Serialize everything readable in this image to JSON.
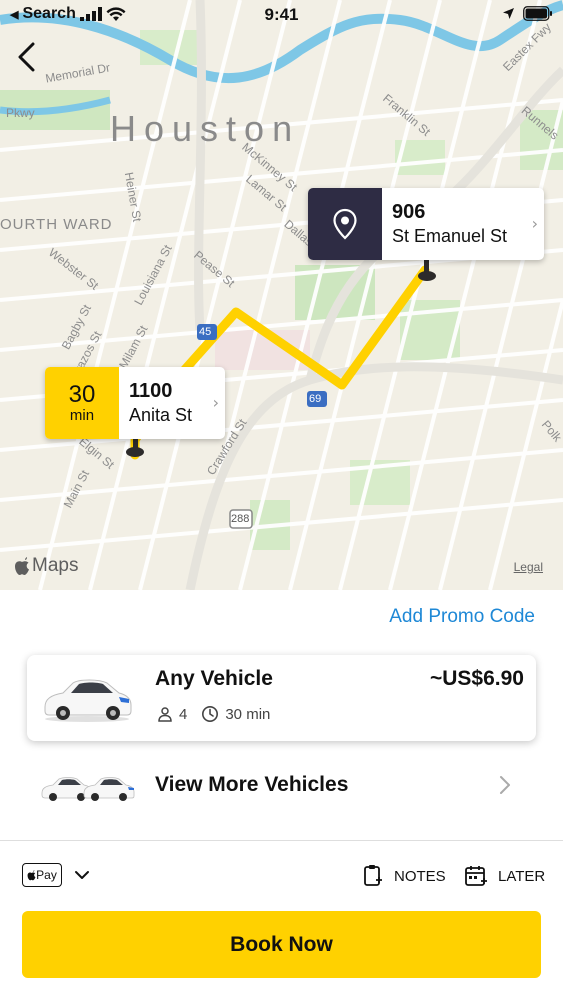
{
  "status_bar": {
    "back_app": "Search",
    "time": "9:41"
  },
  "map": {
    "city": "Houston",
    "streets": [
      "Memorial Dr",
      "Pkwy",
      "Franklin St",
      "Eastex Fwy",
      "Runnels",
      "McKinney St",
      "Lamar St",
      "Dallas",
      "Heiner St",
      "Webster St",
      "Louisiana St",
      "Pease St",
      "Bagby St",
      "Brazos St",
      "Milam St",
      "Elgin St",
      "Main St",
      "Crawford St",
      "Polk"
    ],
    "ward": "OURTH WARD",
    "highway_shields": [
      "45",
      "69",
      "288"
    ],
    "provider": "Maps",
    "legal": "Legal"
  },
  "destination": {
    "number": "906",
    "street": "St Emanuel St"
  },
  "pickup": {
    "eta_value": "30",
    "eta_unit": "min",
    "number": "1100",
    "street": "Anita St"
  },
  "promo_label": "Add Promo Code",
  "vehicle": {
    "name": "Any Vehicle",
    "price": "~US$6.90",
    "seats": "4",
    "duration": "30 min"
  },
  "more_vehicles_label": "View More Vehicles",
  "payment": {
    "method": "Pay"
  },
  "actions": {
    "notes": "NOTES",
    "later": "LATER"
  },
  "book_label": "Book Now",
  "colors": {
    "accent": "#ffd100",
    "link": "#1e88d6",
    "dark_badge": "#2e2c44"
  }
}
